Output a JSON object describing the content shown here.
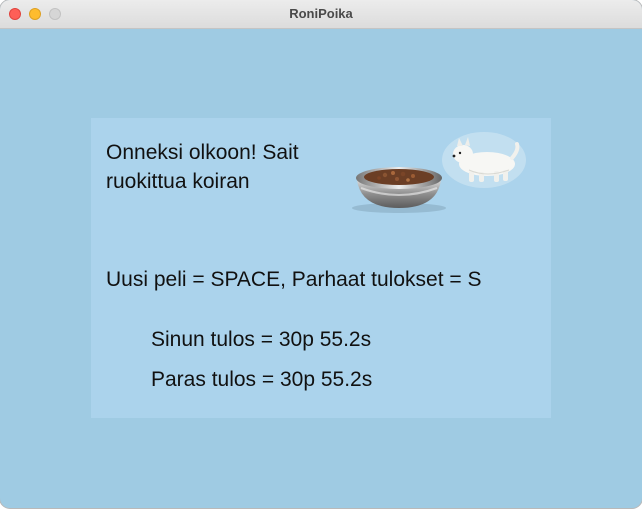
{
  "window": {
    "title": "RoniPoika",
    "controls": {
      "close": "close-button",
      "minimize": "minimize-button",
      "maximize": "zoom-button"
    }
  },
  "game_over": {
    "message": "Onneksi olkoon! Sait ruokittua koiran",
    "instructions": "Uusi peli = SPACE, Parhaat tulokset = S",
    "your_score": "Sinun tulos = 30p 55.2s",
    "best_score": "Paras tulos = 30p 55.2s"
  },
  "images": {
    "bowl": "dog-food-bowl",
    "dog": "white-terrier-dog"
  },
  "colors": {
    "background": "#9fcbe3",
    "panel": "#abd3ec",
    "text": "#111111"
  }
}
